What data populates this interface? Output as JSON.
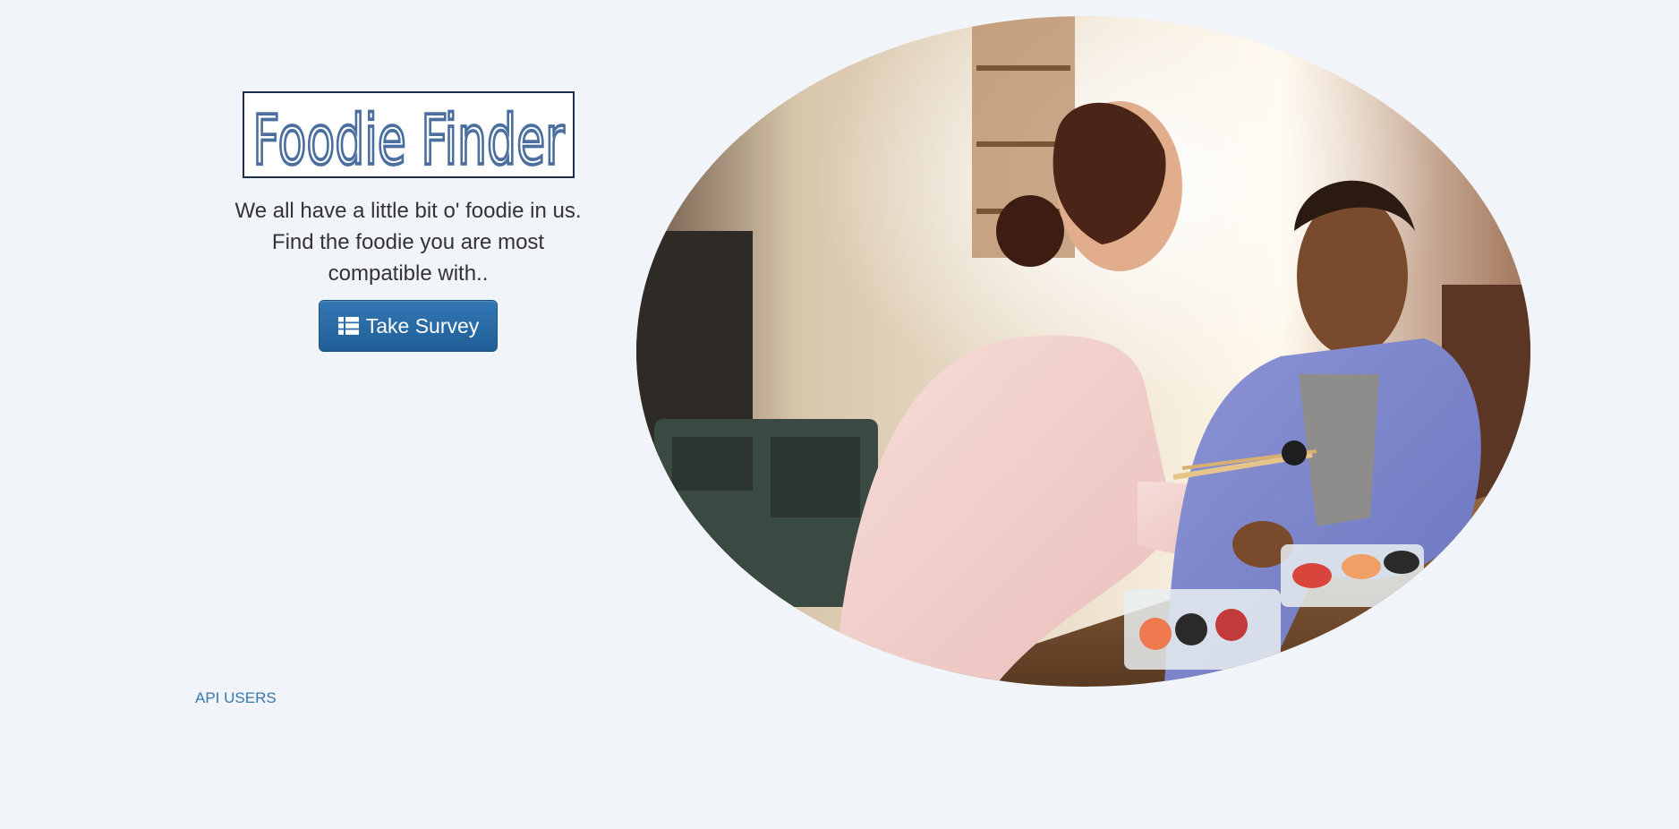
{
  "logo": {
    "text": "Foodie Finder"
  },
  "intro": {
    "tagline_line1": "We all have a little bit o' foodie in us.",
    "tagline_line2": "Find the foodie you are most",
    "tagline_line3": "compatible with.."
  },
  "actions": {
    "survey_label": "Take Survey",
    "survey_icon": "list-icon"
  },
  "footer": {
    "api_link_label": "API USERS"
  },
  "colors": {
    "background": "#f1f4f9",
    "button": "#2a6aa6",
    "link": "#3a78ad",
    "logo_text": "#4b6f9e",
    "logo_border": "#1c2f4f"
  }
}
